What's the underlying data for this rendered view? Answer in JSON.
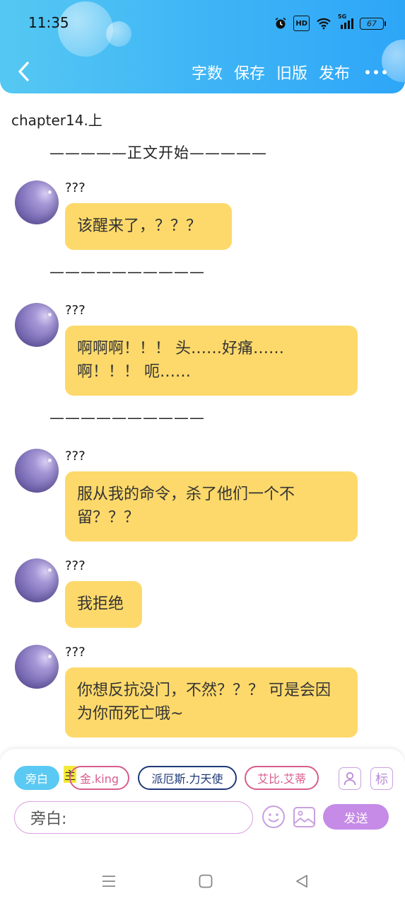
{
  "status_bar": {
    "time": "11:35",
    "icons": [
      "alarm-icon",
      "hd-icon",
      "wifi-icon",
      "5g-signal-icon",
      "battery-icon"
    ],
    "hd_label": "HD",
    "network_label": "5G",
    "battery_level": "67"
  },
  "header": {
    "back_icon": "chevron-left-icon",
    "actions": {
      "word_count": "字数",
      "save": "保存",
      "old_version": "旧版",
      "publish": "发布"
    },
    "more_icon": "more-dots-icon"
  },
  "chapter_title": "chapter14.上",
  "content": {
    "start_marker": "—————正文开始—————",
    "separator": "——————————",
    "messages": [
      {
        "speaker": "???",
        "text": "该醒来了，？？？"
      },
      {
        "speaker": "???",
        "text": "啊啊啊！！！ 头……好痛……\n啊！！！ 呃……"
      },
      {
        "speaker": "???",
        "text": "服从我的命令，杀了他们一个不留？？？"
      },
      {
        "speaker": "???",
        "text": "我拒绝"
      },
      {
        "speaker": "???",
        "text": "你想反抗没门，不然？？？ 可是会因为你而死亡哦~"
      }
    ]
  },
  "composer": {
    "roles": {
      "narration": "旁白",
      "host_tag": "主",
      "role1": "金.king",
      "role2": "派厄斯.力天使",
      "role3": "艾比.艾蒂"
    },
    "role_icon": "person-icon",
    "tag_icon_label": "标",
    "input_value": "旁白:",
    "emoji_icon": "smiley-icon",
    "image_icon": "image-icon",
    "send_label": "发送"
  },
  "nav_bar": {
    "icons": [
      "menu-icon",
      "home-square-icon",
      "back-triangle-icon"
    ]
  },
  "colors": {
    "header_gradient_start": "#55c8f2",
    "header_gradient_end": "#2ea6f7",
    "message_bubble": "#fdd96b",
    "narration_chip": "#5ac9f3",
    "pink_role": "#d75c8c",
    "navy_role": "#1f3a78",
    "send_button": "#c58be6"
  }
}
